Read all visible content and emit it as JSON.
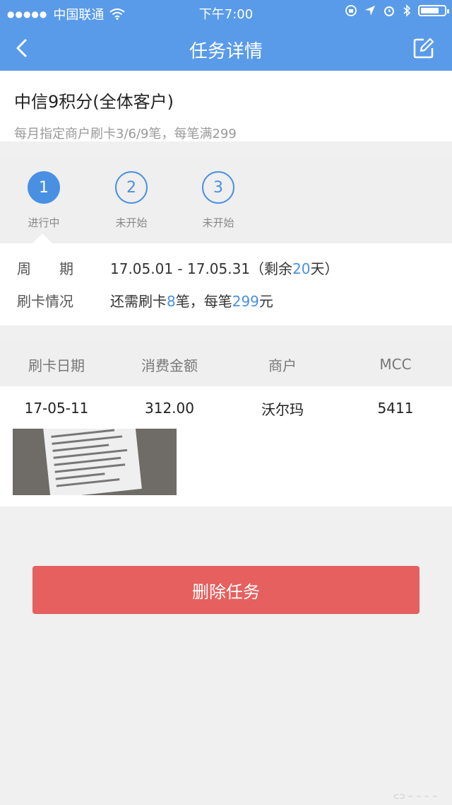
{
  "status_bar": {
    "signal_dots": "●●●●●",
    "carrier": "中国联通",
    "time": "下午7:00",
    "battery_level": 0.8
  },
  "nav": {
    "title": "任务详情"
  },
  "task": {
    "title": "中信9积分(全体客户)",
    "subtitle": "每月指定商户刷卡3/6/9笔，每笔满299"
  },
  "steps": [
    {
      "number": "1",
      "label": "进行中",
      "active": true
    },
    {
      "number": "2",
      "label": "未开始",
      "active": false
    },
    {
      "number": "3",
      "label": "未开始",
      "active": false
    }
  ],
  "info": {
    "period_label": "周　　期",
    "period_prefix": "17.05.01 - 17.05.31（剩余",
    "period_days": "20",
    "period_suffix": "天）",
    "swipe_label": "刷卡情况",
    "swipe_prefix": "还需刷卡",
    "swipe_count": "8",
    "swipe_middle": "笔，每笔",
    "swipe_amount": "299",
    "swipe_suffix": "元"
  },
  "table": {
    "headers": [
      "刷卡日期",
      "消费金额",
      "商户",
      "MCC"
    ],
    "rows": [
      [
        "17-05-11",
        "312.00",
        "沃尔玛",
        "5411"
      ]
    ]
  },
  "delete_button": "删除任务",
  "colors": {
    "primary": "#5a9be9",
    "accent": "#4a90e2",
    "danger": "#e5605e"
  }
}
